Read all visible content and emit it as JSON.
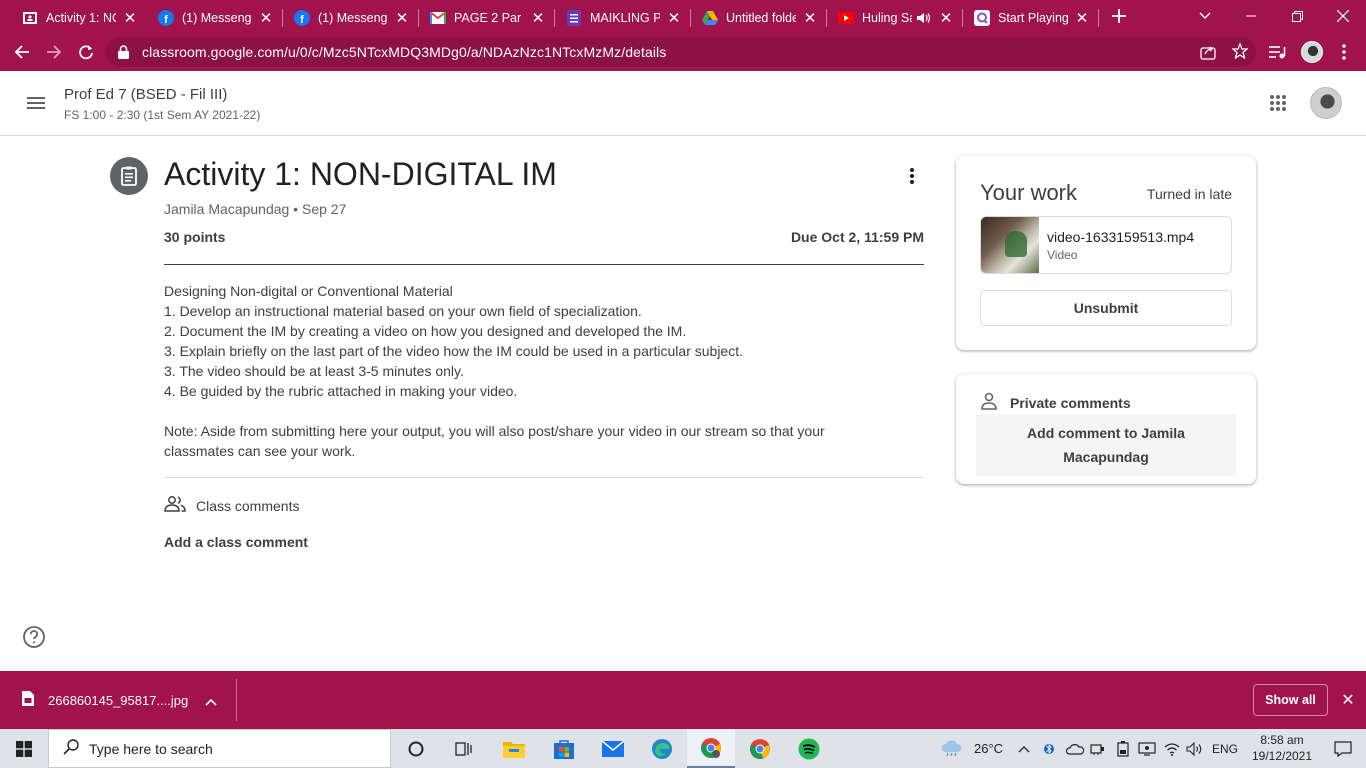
{
  "browser": {
    "tabs": [
      {
        "title": "Activity 1: NO",
        "icon": "classroom-icon"
      },
      {
        "title": "(1) Messenge",
        "icon": "facebook-icon"
      },
      {
        "title": "(1) Messenge",
        "icon": "facebook-icon"
      },
      {
        "title": "PAGE 2 Par - ",
        "icon": "gmail-icon"
      },
      {
        "title": "MAIKLING PA",
        "icon": "forms-icon"
      },
      {
        "title": "Untitled folde",
        "icon": "drive-icon"
      },
      {
        "title": "Huling Sa",
        "icon": "youtube-icon"
      },
      {
        "title": "Start Playing",
        "icon": "quizizz-icon"
      }
    ],
    "url": "classroom.google.com/u/0/c/Mzc5NTcxMDQ3MDg0/a/NDAzNzc1NTcxMzMz/details"
  },
  "header": {
    "class_title": "Prof Ed 7 (BSED - Fil III)",
    "class_subtitle": "FS 1:00 - 2:30 (1st Sem AY 2021-22)"
  },
  "assignment": {
    "title": "Activity 1: NON-DIGITAL IM",
    "meta": "Jamila Macapundag • Sep 27",
    "points": "30 points",
    "due": "Due Oct 2, 11:59 PM",
    "description": [
      "Designing Non-digital or Conventional Material",
      "1. Develop an instructional material based on your own field of specialization.",
      "2. Document the IM by creating a video on how you designed and developed the IM.",
      "3. Explain briefly on the last part of the video how the IM could be used in a particular subject.",
      "3. The video should be at least 3-5 minutes only.",
      "4. Be guided by the rubric attached in making your video."
    ],
    "note": [
      "Note: Aside from submitting here your output, you will also post/share your video in our stream so that your",
      "classmates can see your work."
    ],
    "class_comments_label": "Class comments",
    "add_class_comment": "Add a class comment"
  },
  "your_work": {
    "title": "Your work",
    "status": "Turned in late",
    "attachment_name": "video-1633159513.mp4",
    "attachment_type": "Video",
    "unsubmit_label": "Unsubmit"
  },
  "private_comments": {
    "label": "Private comments",
    "add_line1": "Add comment to Jamila",
    "add_line2": "Macapundag"
  },
  "download_bar": {
    "file_name": "266860145_95817....jpg",
    "show_all": "Show all"
  },
  "taskbar": {
    "search_placeholder": "Type here to search",
    "temperature": "26°C",
    "language": "ENG",
    "time": "8:58 am",
    "date": "19/12/2021"
  },
  "colors": {
    "browser_accent": "#a0134d",
    "taskbar": "#dfe3e8"
  }
}
